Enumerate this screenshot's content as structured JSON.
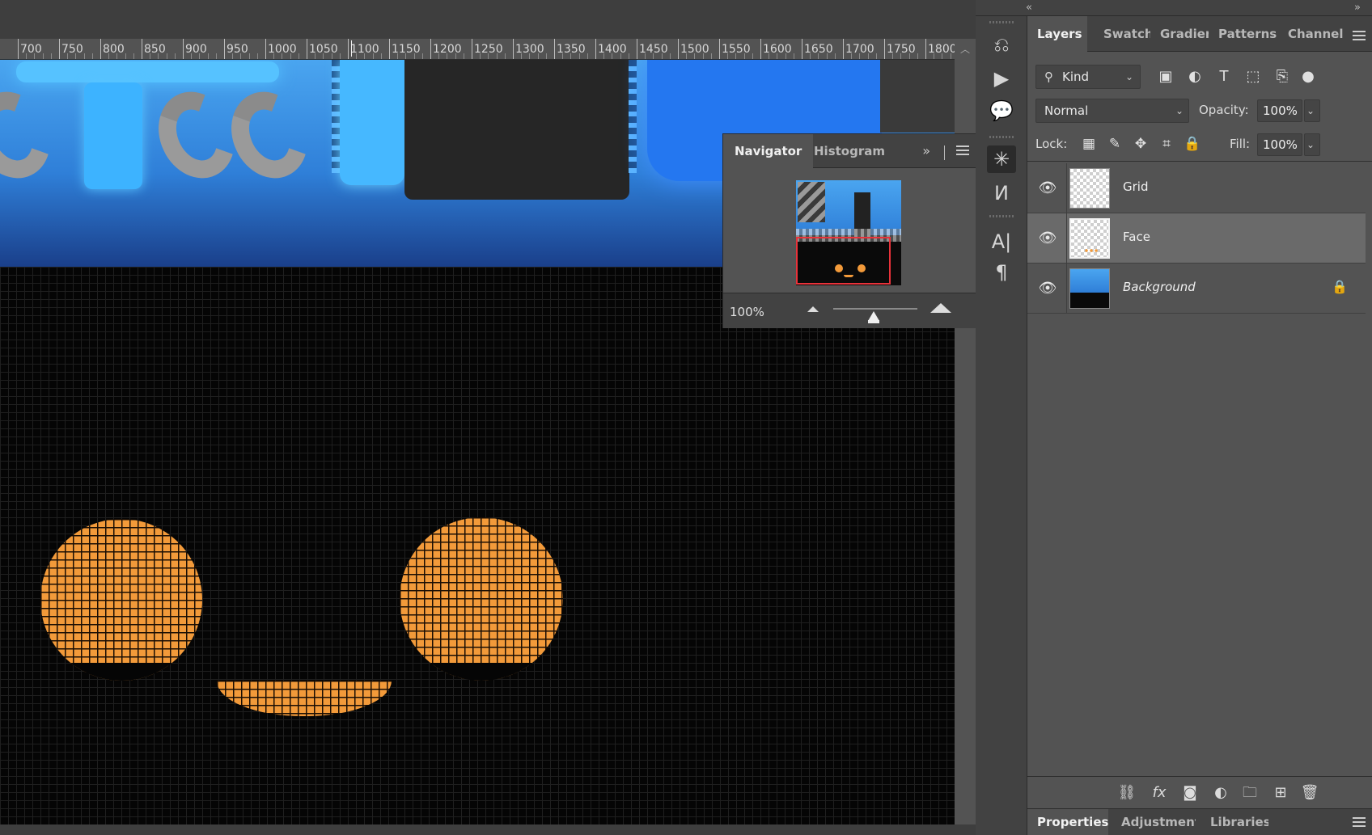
{
  "ruler": {
    "labels": [
      "700",
      "750",
      "800",
      "850",
      "900",
      "950",
      "1000",
      "1050",
      "1100",
      "1150",
      "1200",
      "1250",
      "1300",
      "1350",
      "1400",
      "1450",
      "1500",
      "1550",
      "1600",
      "1650",
      "1700",
      "1750",
      "1800"
    ]
  },
  "navigator": {
    "tabs": [
      "Navigator",
      "Histogram"
    ],
    "active_tab": "Navigator",
    "more_glyph": "»",
    "zoom": "100%"
  },
  "dock": {
    "collapse_left": "«",
    "collapse_right": "»",
    "icons": [
      "history-icon",
      "play-icon",
      "comment-icon",
      "3d-icon",
      "histogram-icon",
      "character-icon",
      "paragraph-icon"
    ]
  },
  "layers_panel": {
    "tabs": [
      "Layers",
      "Swatches",
      "Gradients",
      "Patterns",
      "Channels"
    ],
    "active_tab": "Layers",
    "filter": {
      "kind": "Kind"
    },
    "blend_mode": "Normal",
    "opacity_label": "Opacity:",
    "opacity": "100%",
    "lock_label": "Lock:",
    "fill_label": "Fill:",
    "fill": "100%",
    "layers": [
      {
        "name": "Grid",
        "visible": true,
        "selected": false,
        "locked": false
      },
      {
        "name": "Face",
        "visible": true,
        "selected": true,
        "locked": false
      },
      {
        "name": "Background",
        "visible": true,
        "selected": false,
        "locked": true
      }
    ]
  },
  "bottom_tabs": {
    "tabs": [
      "Properties",
      "Adjustments",
      "Libraries"
    ],
    "active_tab": "Properties"
  },
  "colors": {
    "accent_orange": "#f29a3a",
    "nav_view_red": "#e8323a",
    "sky_blue": "#4aa5f0",
    "panel_bg": "#535353"
  }
}
